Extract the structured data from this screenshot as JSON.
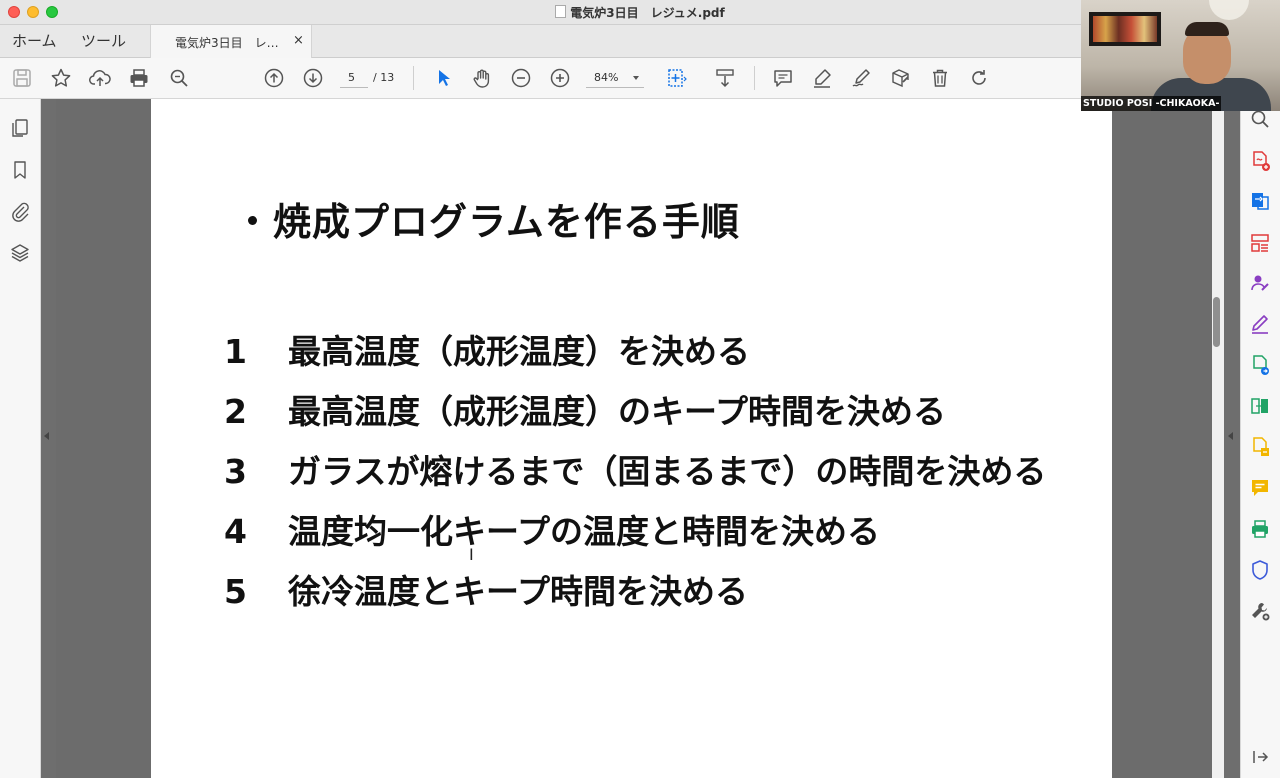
{
  "window": {
    "title": "電気炉3日目　レジュメ.pdf"
  },
  "nav": {
    "home": "ホーム",
    "tools": "ツール"
  },
  "doc_tab": {
    "label": "電気炉3日目　レ…",
    "close": "×"
  },
  "toolbar": {
    "page_current": "5",
    "page_total": "/ 13",
    "zoom": "84%"
  },
  "slide": {
    "title": "焼成プログラムを作る手順",
    "steps": [
      {
        "num": "1",
        "text": "最高温度（成形温度）を決める"
      },
      {
        "num": "2",
        "text": "最高温度（成形温度）のキープ時間を決める"
      },
      {
        "num": "3",
        "text": "ガラスが熔けるまで（固まるまで）の時間を決める"
      },
      {
        "num": "4",
        "text": "温度均一化キープの温度と時間を決める"
      },
      {
        "num": "5",
        "text": "徐冷温度とキープ時間を決める"
      }
    ]
  },
  "webcam": {
    "label": "STUDIO POSI -CHIKAOKA-"
  },
  "colors": {
    "accent_blue": "#1473e6",
    "pdf_red": "#e03a3a",
    "purple": "#8a3ec2",
    "green": "#21a366",
    "yellow": "#f2b600"
  }
}
